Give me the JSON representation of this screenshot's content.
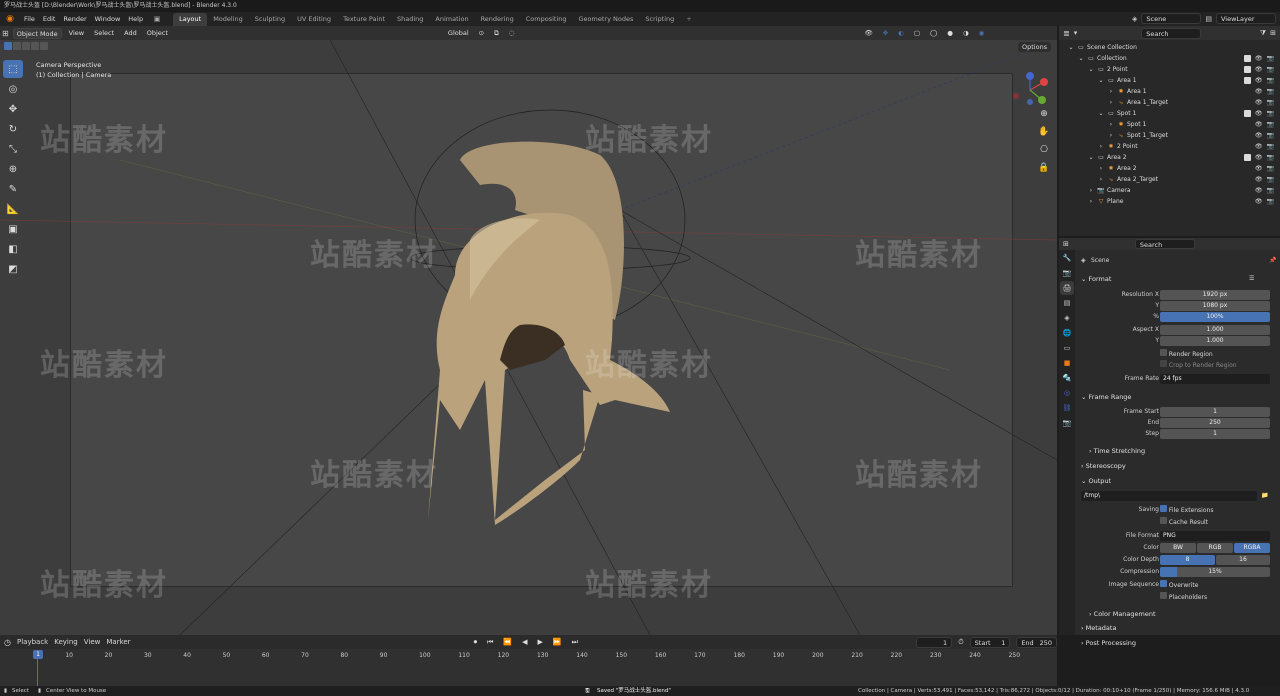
{
  "window_title": "罗马战士头盔 [D:\\Blender\\Work\\罗马战士头盔\\罗马战士头盔.blend] - Blender 4.3.0",
  "menu": [
    "File",
    "Edit",
    "Render",
    "Window",
    "Help"
  ],
  "workspace_tabs": [
    "Layout",
    "Modeling",
    "Sculpting",
    "UV Editing",
    "Texture Paint",
    "Shading",
    "Animation",
    "Rendering",
    "Compositing",
    "Geometry Nodes",
    "Scripting"
  ],
  "active_workspace": "Layout",
  "top_right": {
    "scene": "Scene",
    "view_layer": "ViewLayer"
  },
  "viewport_header": {
    "mode": "Object Mode",
    "view": "View",
    "select": "Select",
    "add": "Add",
    "object": "Object",
    "transform_orientation": "Global",
    "options": "Options"
  },
  "viewport_info": {
    "line1": "Camera Perspective",
    "line2": "(1) Collection | Camera"
  },
  "watermark": "站酷素材",
  "outliner": {
    "search_placeholder": "Search",
    "rows": [
      {
        "label": "Scene Collection",
        "indent": 0,
        "icon": "collection-icon"
      },
      {
        "label": "Collection",
        "indent": 1,
        "icon": "collection-icon"
      },
      {
        "label": "2 Point",
        "indent": 2,
        "icon": "collection-icon"
      },
      {
        "label": "Area 1",
        "indent": 3,
        "icon": "collection-icon"
      },
      {
        "label": "Area 1",
        "indent": 4,
        "icon": "light-icon"
      },
      {
        "label": "Area 1_Target",
        "indent": 4,
        "icon": "empty-icon"
      },
      {
        "label": "Spot 1",
        "indent": 3,
        "icon": "collection-icon"
      },
      {
        "label": "Spot 1",
        "indent": 4,
        "icon": "light-icon"
      },
      {
        "label": "Spot 1_Target",
        "indent": 4,
        "icon": "empty-icon"
      },
      {
        "label": "2 Point",
        "indent": 3,
        "icon": "light-icon"
      },
      {
        "label": "Area 2",
        "indent": 2,
        "icon": "collection-icon"
      },
      {
        "label": "Area 2",
        "indent": 3,
        "icon": "light-icon"
      },
      {
        "label": "Area 2_Target",
        "indent": 3,
        "icon": "empty-icon"
      },
      {
        "label": "Camera",
        "indent": 2,
        "icon": "camera-icon"
      },
      {
        "label": "Plane",
        "indent": 2,
        "icon": "mesh-icon"
      }
    ]
  },
  "properties": {
    "search_placeholder": "Search",
    "context": "Scene",
    "format_section": "Format",
    "resolution_x_label": "Resolution X",
    "resolution_x": "1920 px",
    "y_label": "Y",
    "resolution_y": "1080 px",
    "percent_label": "%",
    "resolution_pct": "100%",
    "aspect_x_label": "Aspect X",
    "aspect_x": "1.000",
    "aspect_y": "1.000",
    "render_region": "Render Region",
    "crop_region": "Crop to Render Region",
    "frame_rate_label": "Frame Rate",
    "frame_rate": "24 fps",
    "frame_range_section": "Frame Range",
    "frame_start_label": "Frame Start",
    "frame_start": "1",
    "end_label": "End",
    "frame_end": "250",
    "step_label": "Step",
    "frame_step": "1",
    "time_stretching": "Time Stretching",
    "stereoscopy": "Stereoscopy",
    "output_section": "Output",
    "output_path": "/tmp\\",
    "saving_label": "Saving",
    "file_extensions": "File Extensions",
    "cache_result": "Cache Result",
    "file_format_label": "File Format",
    "file_format": "PNG",
    "color_label": "Color",
    "color_options": [
      "BW",
      "RGB",
      "RGBA"
    ],
    "color_selected": "RGBA",
    "color_depth_label": "Color Depth",
    "color_depth_options": [
      "8",
      "16"
    ],
    "compression_label": "Compression",
    "compression": "15%",
    "compression_fraction": 0.15,
    "image_sequence_label": "Image Sequence",
    "overwrite": "Overwrite",
    "placeholders": "Placeholders",
    "color_management": "Color Management",
    "metadata": "Metadata",
    "post_processing": "Post Processing"
  },
  "timeline": {
    "playback": "Playback",
    "keying": "Keying",
    "view": "View",
    "marker": "Marker",
    "current_frame": "1",
    "start_label": "Start",
    "start": "1",
    "end_label": "End",
    "end": "250",
    "ticks": [
      "1",
      "10",
      "20",
      "30",
      "40",
      "50",
      "60",
      "70",
      "80",
      "90",
      "100",
      "110",
      "120",
      "130",
      "140",
      "150",
      "160",
      "170",
      "180",
      "190",
      "200",
      "210",
      "220",
      "230",
      "240",
      "250"
    ]
  },
  "statusbar": {
    "select": "Select",
    "center_view": "Center View to Mouse",
    "saved": "Saved \"罗马战士头盔.blend\"",
    "stats": "Collection | Camera | Verts:53,491 | Faces:53,142 | Tris:86,272 | Objects:0/12 | Duration: 00:10+10 (Frame 1/250) | Memory: 156.6 MiB | 4.3.0"
  },
  "colors": {
    "accent": "#4772b3",
    "brand": "#e87d0d",
    "helmet": "#b9a27c"
  }
}
